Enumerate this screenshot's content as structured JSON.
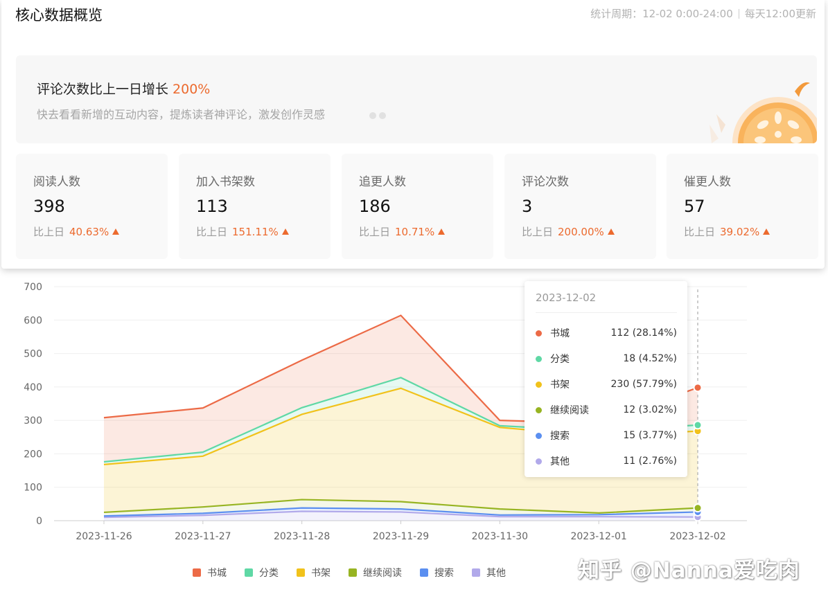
{
  "overview": {
    "title": "核心数据概览",
    "period": "统计周期：12-02 0:00-24:00",
    "update": "每天12:00更新"
  },
  "banner": {
    "headline": "评论次数比上一日增长",
    "headline_accent": "200%",
    "sub": "快去看看新增的互动内容，提炼读者神评论，激发创作灵感"
  },
  "metrics": [
    {
      "label": "阅读人数",
      "value": "398",
      "cmp_label": "比上日",
      "cmp_value": "40.63%"
    },
    {
      "label": "加入书架数",
      "value": "113",
      "cmp_label": "比上日",
      "cmp_value": "151.11%"
    },
    {
      "label": "追更人数",
      "value": "186",
      "cmp_label": "比上日",
      "cmp_value": "10.71%"
    },
    {
      "label": "评论次数",
      "value": "3",
      "cmp_label": "比上日",
      "cmp_value": "200.00%"
    },
    {
      "label": "催更人数",
      "value": "57",
      "cmp_label": "比上日",
      "cmp_value": "39.02%"
    }
  ],
  "colors": {
    "accent": "#ec6a2e",
    "书城": "#ec6a46",
    "分类": "#5fd8a5",
    "书架": "#f1c21b",
    "继续阅读": "#97b422",
    "搜索": "#5b8ff0",
    "其他": "#b1a9ea"
  },
  "tooltip": {
    "date": "2023-12-02",
    "rows": [
      {
        "name": "书城",
        "value": "112 (28.14%)",
        "color": "#ec6a46"
      },
      {
        "name": "分类",
        "value": "18 (4.52%)",
        "color": "#5fd8a5"
      },
      {
        "name": "书架",
        "value": "230 (57.79%)",
        "color": "#f1c21b"
      },
      {
        "name": "继续阅读",
        "value": "12 (3.02%)",
        "color": "#97b422"
      },
      {
        "name": "搜索",
        "value": "15 (3.77%)",
        "color": "#5b8ff0"
      },
      {
        "name": "其他",
        "value": "11 (2.76%)",
        "color": "#b1a9ea"
      }
    ]
  },
  "chart_data": {
    "type": "area",
    "stacked": true,
    "x": [
      "2023-11-26",
      "2023-11-27",
      "2023-11-28",
      "2023-11-29",
      "2023-11-30",
      "2023-12-01",
      "2023-12-02"
    ],
    "ylim": [
      0,
      700
    ],
    "yticks": [
      0,
      100,
      200,
      300,
      400,
      500,
      600,
      700
    ],
    "grid": true,
    "legend_position": "bottom",
    "series": [
      {
        "name": "其他",
        "color": "#b1a9ea",
        "values": [
          10,
          16,
          28,
          26,
          12,
          12,
          11
        ]
      },
      {
        "name": "搜索",
        "color": "#5b8ff0",
        "values": [
          4,
          6,
          10,
          9,
          5,
          6,
          15
        ]
      },
      {
        "name": "继续阅读",
        "color": "#97b422",
        "values": [
          11,
          19,
          25,
          22,
          18,
          5,
          12
        ]
      },
      {
        "name": "书架",
        "color": "#f1c21b",
        "values": [
          143,
          152,
          255,
          339,
          244,
          230,
          230
        ]
      },
      {
        "name": "分类",
        "color": "#5fd8a5",
        "values": [
          8,
          12,
          20,
          32,
          5,
          15,
          18
        ]
      },
      {
        "name": "书城",
        "color": "#ec6a46",
        "values": [
          132,
          132,
          142,
          186,
          16,
          23,
          112
        ]
      }
    ],
    "legend": [
      "书城",
      "分类",
      "书架",
      "继续阅读",
      "搜索",
      "其他"
    ]
  },
  "watermark": "知乎 @Nanna爱吃肉"
}
